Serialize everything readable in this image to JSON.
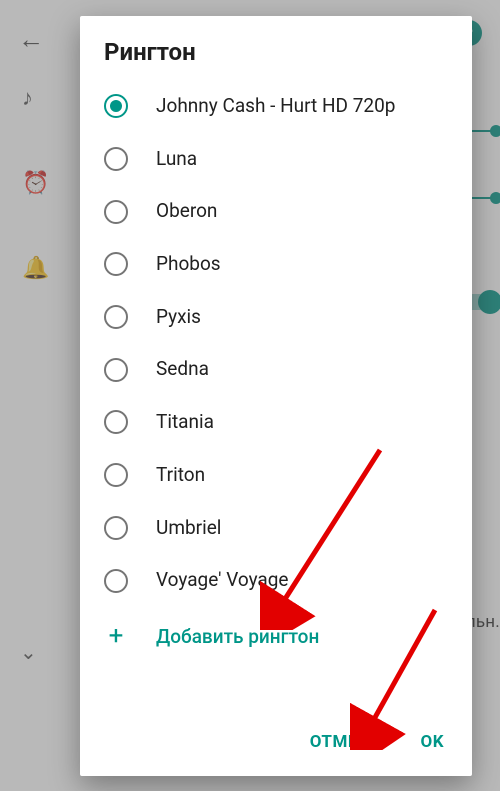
{
  "dialog": {
    "title": "Рингтон",
    "options": [
      {
        "label": "Johnny Cash - Hurt HD 720p",
        "selected": true
      },
      {
        "label": "Luna",
        "selected": false
      },
      {
        "label": "Oberon",
        "selected": false
      },
      {
        "label": "Phobos",
        "selected": false
      },
      {
        "label": "Pyxis",
        "selected": false
      },
      {
        "label": "Sedna",
        "selected": false
      },
      {
        "label": "Titania",
        "selected": false
      },
      {
        "label": "Triton",
        "selected": false
      },
      {
        "label": "Umbriel",
        "selected": false
      },
      {
        "label": "Voyage' Voyage",
        "selected": false
      }
    ],
    "add_label": "Добавить рингтон",
    "cancel_label": "ОТМЕНА",
    "ok_label": "OK"
  },
  "backdrop": {
    "partial_text": "дильн."
  }
}
